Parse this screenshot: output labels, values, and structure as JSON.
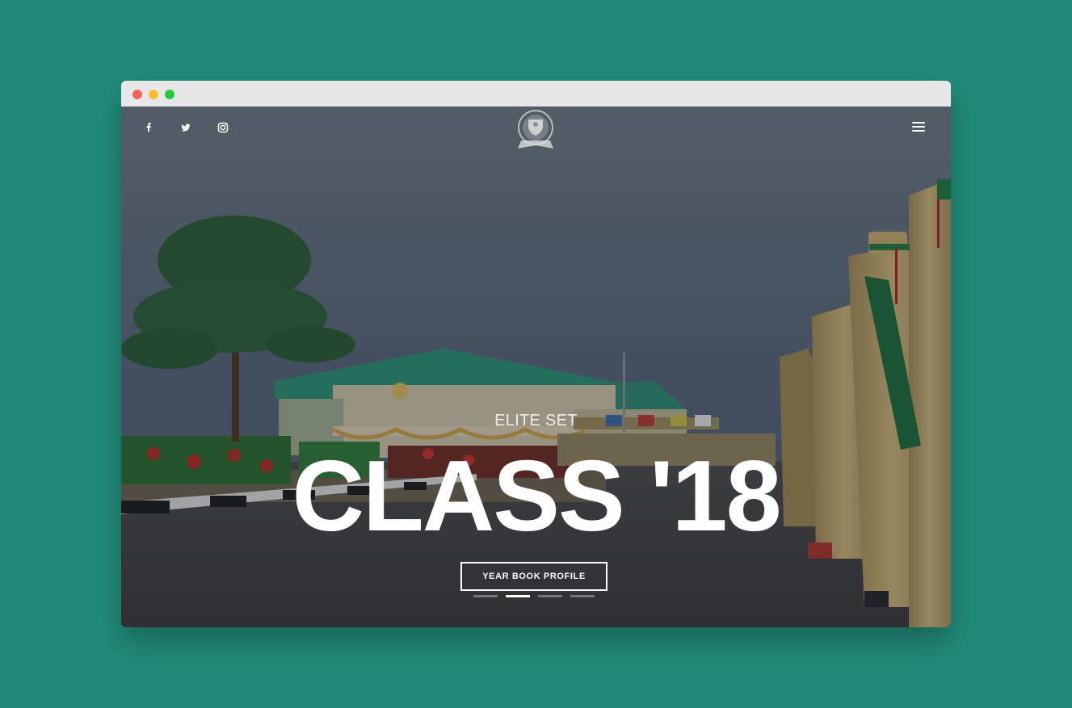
{
  "window": {
    "controls": [
      "close",
      "minimize",
      "maximize"
    ]
  },
  "nav": {
    "social": [
      {
        "name": "facebook-icon"
      },
      {
        "name": "twitter-icon"
      },
      {
        "name": "instagram-icon"
      }
    ],
    "logo": "crest-logo",
    "menu": "hamburger-menu-icon"
  },
  "hero": {
    "subtitle": "ELITE SET",
    "title": "CLASS '18",
    "cta_label": "YEAR BOOK PROFILE",
    "slides": [
      false,
      true,
      false,
      false
    ]
  },
  "colors": {
    "page_background": "#228b79",
    "titlebar": "#e7e7e7",
    "text": "#ffffff"
  }
}
